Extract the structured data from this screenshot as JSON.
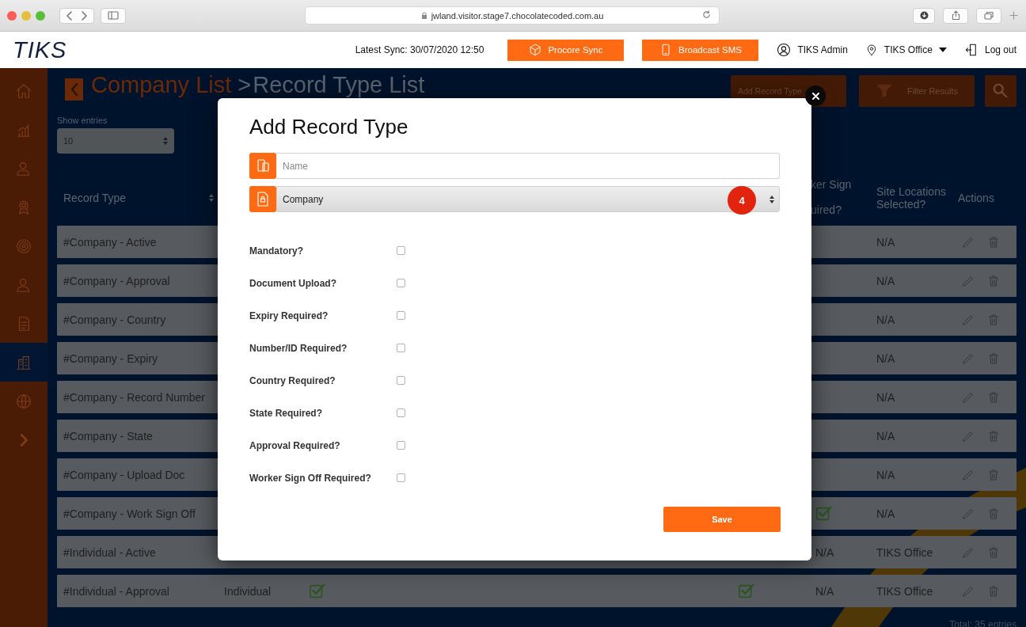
{
  "browser": {
    "url": "jwland.visitor.stage7.chocolatecoded.com.au"
  },
  "header": {
    "logo": "TIKS",
    "sync": "Latest Sync: 30/07/2020 12:50",
    "buttons": [
      {
        "label": "Procore Sync"
      },
      {
        "label": "Broadcast SMS"
      }
    ],
    "user": "TIKS Admin",
    "location": "TIKS Office",
    "logout": "Log out"
  },
  "sidebar": {
    "items": [
      {
        "selected": false
      },
      {
        "selected": false
      },
      {
        "selected": false
      },
      {
        "selected": false
      },
      {
        "selected": false
      },
      {
        "selected": false
      },
      {
        "selected": false
      },
      {
        "selected": true
      },
      {
        "selected": false
      },
      {
        "selected": false
      }
    ]
  },
  "page": {
    "breadcrumb": [
      {
        "label": "Company List"
      },
      {
        "label": "Record Type List"
      }
    ],
    "separator": ">",
    "actions": [
      {
        "label": "Add Record Type"
      },
      {
        "label": "Filter Results"
      }
    ],
    "show_entries": {
      "label": "Show entries",
      "value": "10"
    }
  },
  "table": {
    "columns": {
      "record_type": "Record Type",
      "column_4": {
        "line_1": "ker Sign",
        "line_3": "uired?"
      },
      "site_locations": "Site Locations Selected?",
      "actions": "Actions"
    },
    "rows": [
      {
        "name": "#Company - Active",
        "site_locations": "N/A"
      },
      {
        "name": "#Company - Approval",
        "site_locations": "N/A"
      },
      {
        "name": "#Company - Country",
        "site_locations": "N/A"
      },
      {
        "name": "#Company - Expiry",
        "site_locations": "N/A"
      },
      {
        "name": "#Company - Record Number",
        "site_locations": "N/A"
      },
      {
        "name": "#Company - State",
        "site_locations": "N/A"
      },
      {
        "name": "#Company - Upload Doc",
        "site_locations": "N/A"
      },
      {
        "name": "#Company - Work Sign Off",
        "sign_off_checked": true,
        "site_locations": "N/A"
      },
      {
        "name": "#Individual - Active",
        "sign_off": "N/A",
        "site_locations": "TIKS Office"
      },
      {
        "name": "#Individual - Approval",
        "type": "Individual",
        "column_3_checked": true,
        "column_4_checked": true,
        "sign_off": "N/A",
        "site_locations": "TIKS Office"
      }
    ],
    "total": "Total: 35 entries"
  },
  "modal": {
    "title": "Add Record Type",
    "name_field": {
      "placeholder": "Name"
    },
    "type_select": {
      "value": "Company",
      "badge": "4"
    },
    "options": [
      {
        "label": "Mandatory?",
        "checked": false
      },
      {
        "label": "Document Upload?",
        "checked": false
      },
      {
        "label": "Expiry Required?",
        "checked": false
      },
      {
        "label": "Number/ID Required?",
        "checked": false
      },
      {
        "label": "Country Required?",
        "checked": false
      },
      {
        "label": "State Required?",
        "checked": false
      },
      {
        "label": "Approval Required?",
        "checked": false
      },
      {
        "label": "Worker Sign Off Required?",
        "checked": false
      }
    ],
    "save": "Save"
  }
}
